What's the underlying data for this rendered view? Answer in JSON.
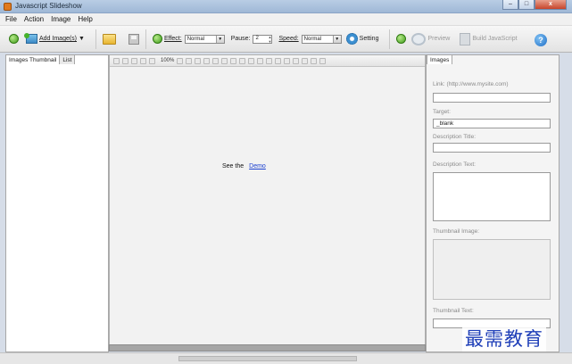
{
  "window": {
    "title": "Javascript Slideshow",
    "controls": {
      "min": "–",
      "max": "□",
      "close": "x"
    }
  },
  "menu": [
    "File",
    "Action",
    "Image",
    "Help"
  ],
  "toolbar": {
    "add_images_label": "Add Image(s)",
    "effect_label": "Effect:",
    "effect_value": "Normal",
    "pause_label": "Pause:",
    "pause_value": "2",
    "speed_label": "Speed:",
    "speed_value": "Normal",
    "setting_label": "Setting",
    "preview_label": "Preview",
    "build_label": "Build JavaScript",
    "help_glyph": "?"
  },
  "left_tabs": {
    "thumbnail": "Images Thumbnail",
    "list": "List"
  },
  "center": {
    "zoom": "100%",
    "see_text": "See the",
    "demo_link": "Demo"
  },
  "right": {
    "tab": "Images",
    "url_label": "Link: (http://www.mysite.com)",
    "url_value": "",
    "target_label": "Target:",
    "target_value": "_blank",
    "desc_title_label": "Description Title:",
    "desc_text_label": "Description Text:",
    "thumb_image_label": "Thumbnail Image:",
    "thumb_text_label": "Thumbnail Text:"
  },
  "watermark": "最需教育",
  "colors": {
    "link": "#1a3fd0",
    "accent_green": "#3f9c1a",
    "title_bar": "#b9cde5"
  }
}
